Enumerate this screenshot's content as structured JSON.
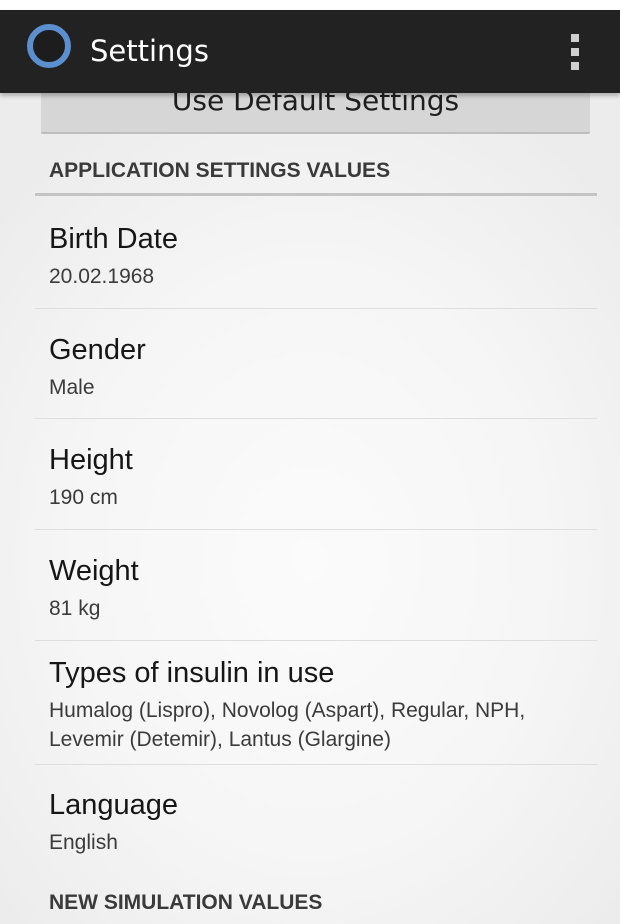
{
  "action_bar": {
    "title": "Settings",
    "overflow_icon": "overflow-menu-icon",
    "app_icon": "ring-logo-icon"
  },
  "default_button_label": "Use Default Settings",
  "sections": {
    "app_settings": "APPLICATION SETTINGS VALUES",
    "new_simulation": "NEW SIMULATION VALUES"
  },
  "prefs": [
    {
      "title": "Birth Date",
      "summary": "20.02.1968"
    },
    {
      "title": "Gender",
      "summary": "Male"
    },
    {
      "title": "Height",
      "summary": "190 cm"
    },
    {
      "title": "Weight",
      "summary": "81 kg"
    },
    {
      "title": "Types of insulin in use",
      "summary": "Humalog (Lispro), Novolog (Aspart), Regular, NPH, Levemir (Detemir), Lantus (Glargine)"
    },
    {
      "title": "Language",
      "summary": "English"
    }
  ],
  "colors": {
    "action_bar": "#222222",
    "accent_ring": "#5b8fd0",
    "background": "#f2f2f2"
  }
}
